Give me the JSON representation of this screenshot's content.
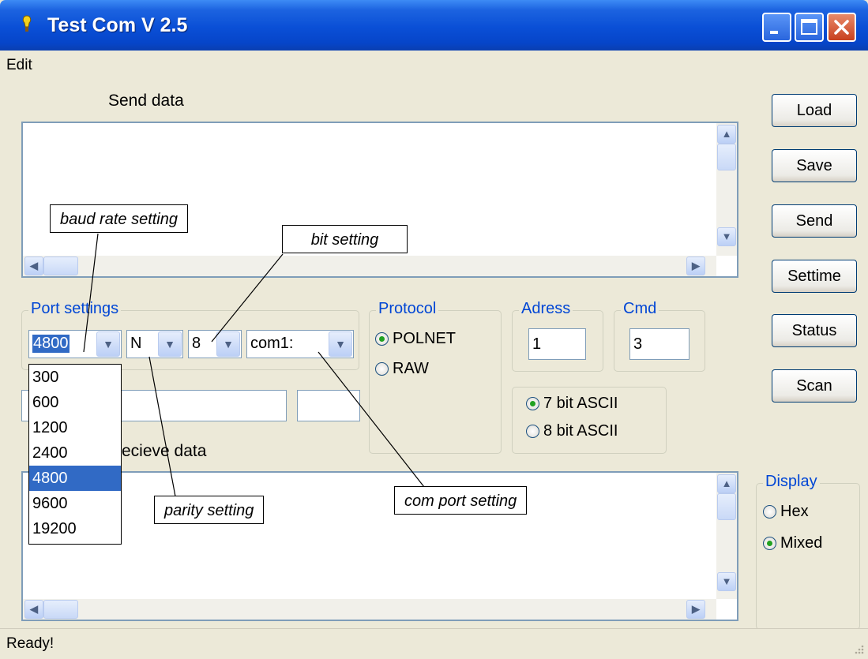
{
  "window": {
    "title": "Test Com V 2.5"
  },
  "menu": {
    "edit": "Edit"
  },
  "send_section": {
    "label": "Send data"
  },
  "receive_section": {
    "label": "ecieve data"
  },
  "buttons": {
    "load": "Load",
    "save": "Save",
    "send": "Send",
    "settime": "Settime",
    "status": "Status",
    "scan": "Scan"
  },
  "port_settings": {
    "legend": "Port settings",
    "baud": "4800",
    "parity": "N",
    "bits": "8",
    "port": "com1:",
    "baud_options": [
      "300",
      "600",
      "1200",
      "2400",
      "4800",
      "9600",
      "19200"
    ],
    "baud_selected": "4800"
  },
  "protocol": {
    "legend": "Protocol",
    "options": [
      "POLNET",
      "RAW"
    ],
    "selected": "POLNET"
  },
  "adress": {
    "legend": "Adress",
    "value": "1"
  },
  "cmd": {
    "legend": "Cmd",
    "value": "3"
  },
  "ascii": {
    "options": [
      "7 bit ASCII",
      "8 bit ASCII"
    ],
    "selected": "7 bit ASCII"
  },
  "display": {
    "legend": "Display",
    "options": [
      "Hex",
      "Mixed"
    ],
    "selected": "Mixed"
  },
  "callouts": {
    "baud": "baud rate setting",
    "bit": "bit setting",
    "parity": "parity setting",
    "com": "com port setting"
  },
  "status": {
    "text": "Ready!"
  },
  "colors": {
    "titlebar": "#0a4fd6",
    "selection": "#316ac5",
    "legend_text": "#0046d5",
    "radio_dot": "#21a121"
  }
}
